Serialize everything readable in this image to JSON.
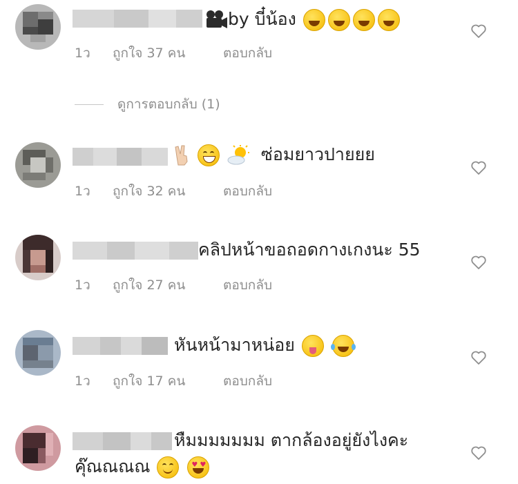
{
  "comments": [
    {
      "text_prefix": "by บี๋น้อง",
      "time": "1ว",
      "likes": "ถูกใจ 37 คน",
      "reply": "ตอบกลับ",
      "emojis": [
        "laughing-emoji",
        "laughing-emoji",
        "laughing-emoji",
        "laughing-emoji"
      ],
      "lead_icon": "movie-camera-icon"
    },
    {
      "text": "ซ่อมยาวปายยย",
      "time": "1ว",
      "likes": "ถูกใจ 32 คน",
      "reply": "ตอบกลับ",
      "emojis": [
        "victory-hand-emoji",
        "grinning-emoji",
        "sun-behind-cloud-emoji"
      ]
    },
    {
      "text": "คลิปหน้าขอถอดกางเกงนะ 55",
      "time": "1ว",
      "likes": "ถูกใจ 27 คน",
      "reply": "ตอบกลับ"
    },
    {
      "text": "หันหน้ามาหน่อย",
      "time": "1ว",
      "likes": "ถูกใจ 17 คน",
      "reply": "ตอบกลับ",
      "emojis": [
        "squinting-tongue-emoji",
        "tears-of-joy-emoji"
      ]
    },
    {
      "text": "หืมมมมมมม ตากล้องอยู่ยังไงคะ",
      "text_line2": "คุ๊ณณณณ",
      "emojis": [
        "smiling-emoji",
        "heart-eyes-emoji"
      ]
    }
  ],
  "view_replies": "ดูการตอบกลับ (1)",
  "icons": {
    "like": "heart-outline-icon"
  },
  "colors": {
    "text": "#262626",
    "meta": "#8e8e8e",
    "heart": "#8e8e8e"
  }
}
